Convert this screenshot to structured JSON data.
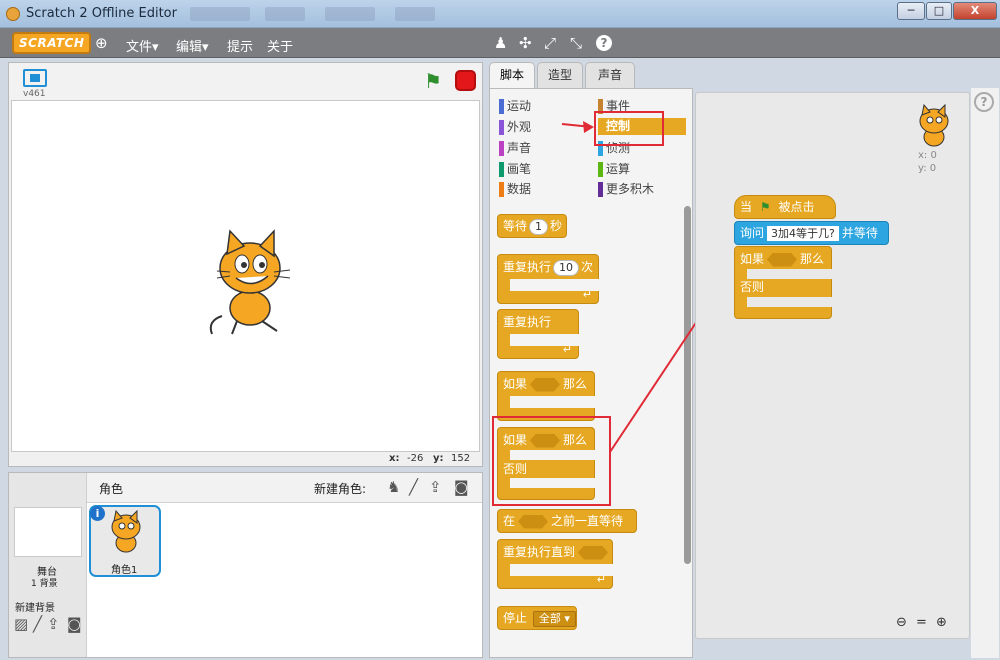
{
  "window": {
    "title": "Scratch 2 Offline Editor",
    "minimize": "─",
    "maximize": "□",
    "close": "X"
  },
  "menubar": {
    "logo": "SCRATCH",
    "items": [
      "文件▾",
      "编辑▾",
      "提示",
      "关于"
    ],
    "globe": "⊕",
    "tools": [
      "♟",
      "✣",
      "⤢",
      "⤡",
      "?"
    ]
  },
  "stage": {
    "version": "v461",
    "x_label": "x:",
    "x_value": "-26",
    "y_label": "y:",
    "y_value": "152"
  },
  "sprites": {
    "header": "角色",
    "new_sprite": "新建角色:",
    "stage_label": "舞台",
    "backdrop_count": "1 背景",
    "new_backdrop": "新建背景",
    "sprite_name": "角色1"
  },
  "tabs": [
    "脚本",
    "造型",
    "声音"
  ],
  "categories": [
    {
      "label": "运动",
      "color": "#4a6cd4"
    },
    {
      "label": "外观",
      "color": "#8a55d7"
    },
    {
      "label": "声音",
      "color": "#bb42c3"
    },
    {
      "label": "画笔",
      "color": "#0e9a6c"
    },
    {
      "label": "数据",
      "color": "#ee7d16"
    },
    {
      "label": "事件",
      "color": "#c88330"
    },
    {
      "label": "控制",
      "color": "#e6a822"
    },
    {
      "label": "侦测",
      "color": "#2ca5e2"
    },
    {
      "label": "运算",
      "color": "#5cb712"
    },
    {
      "label": "更多积木",
      "color": "#632d99"
    }
  ],
  "palette": {
    "wait": "等待",
    "wait_num": "1",
    "wait_unit": "秒",
    "repeat": "重复执行",
    "repeat_num": "10",
    "repeat_unit": "次",
    "forever": "重复执行",
    "if": "如果",
    "then": "那么",
    "if2": "如果",
    "then2": "那么",
    "else": "否则",
    "wait_until": "在",
    "wait_until_tail": "之前一直等待",
    "repeat_until": "重复执行直到",
    "stop": "停止",
    "stop_opt": "全部 ▾"
  },
  "script": {
    "hat": "当",
    "hat_tail": "被点击",
    "ask": "询问",
    "ask_text": "3加4等于几?",
    "ask_tail": "并等待",
    "if": "如果",
    "then": "那么",
    "else": "否则",
    "sprite_x": "x: 0",
    "sprite_y": "y: 0"
  }
}
